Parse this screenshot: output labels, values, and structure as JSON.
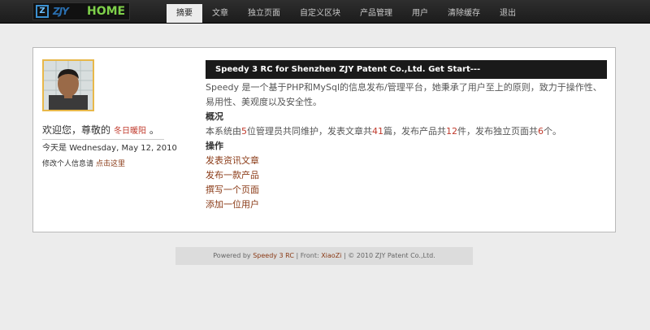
{
  "header": {
    "logo": {
      "mark": "Z",
      "text": "ZJY",
      "home": "HOME"
    },
    "tabs": [
      "摘要",
      "文章",
      "独立页面",
      "自定义区块",
      "产品管理",
      "用户",
      "清除缓存",
      "退出"
    ],
    "active_tab": "摘要"
  },
  "sidebar": {
    "welcome_prefix": "欢迎您，尊敬的",
    "username": "冬日暖阳",
    "welcome_suffix": "。",
    "today_label": "今天是",
    "today_value": "Wednesday, May 12, 2010",
    "edit_label": "修改个人信息请",
    "edit_link": "点击这里"
  },
  "main": {
    "headline": "Speedy 3 RC for Shenzhen ZJY Patent Co.,Ltd. Get Start---",
    "intro": "Speedy 是一个基于PHP和MySql的信息发布/管理平台，她秉承了用户至上的原则，致力于操作性、易用性、美观度以及安全性。",
    "overview_title": "概况",
    "stats": {
      "prefix": "本系统由",
      "admins": "5",
      "t1": "位管理员共同维护，发表文章共",
      "articles": "41",
      "t2": "篇，发布产品共",
      "products": "12",
      "t3": "件，发布独立页面共",
      "pages": "6",
      "t4": "个。"
    },
    "actions_title": "操作",
    "actions": [
      "发表资讯文章",
      "发布一款产品",
      "撰写一个页面",
      "添加一位用户"
    ]
  },
  "footer": {
    "powered_by": "Powered by",
    "product": "Speedy 3 RC",
    "sep1": "|",
    "front_label": "Front:",
    "front_link": "XiaoZi",
    "sep2": "|",
    "copyright": "© 2010 ZJY Patent Co.,Ltd."
  },
  "colors": {
    "accent": "#8a3a16",
    "highlight": "#c0392b",
    "headline_bg": "#1a1a1a"
  }
}
